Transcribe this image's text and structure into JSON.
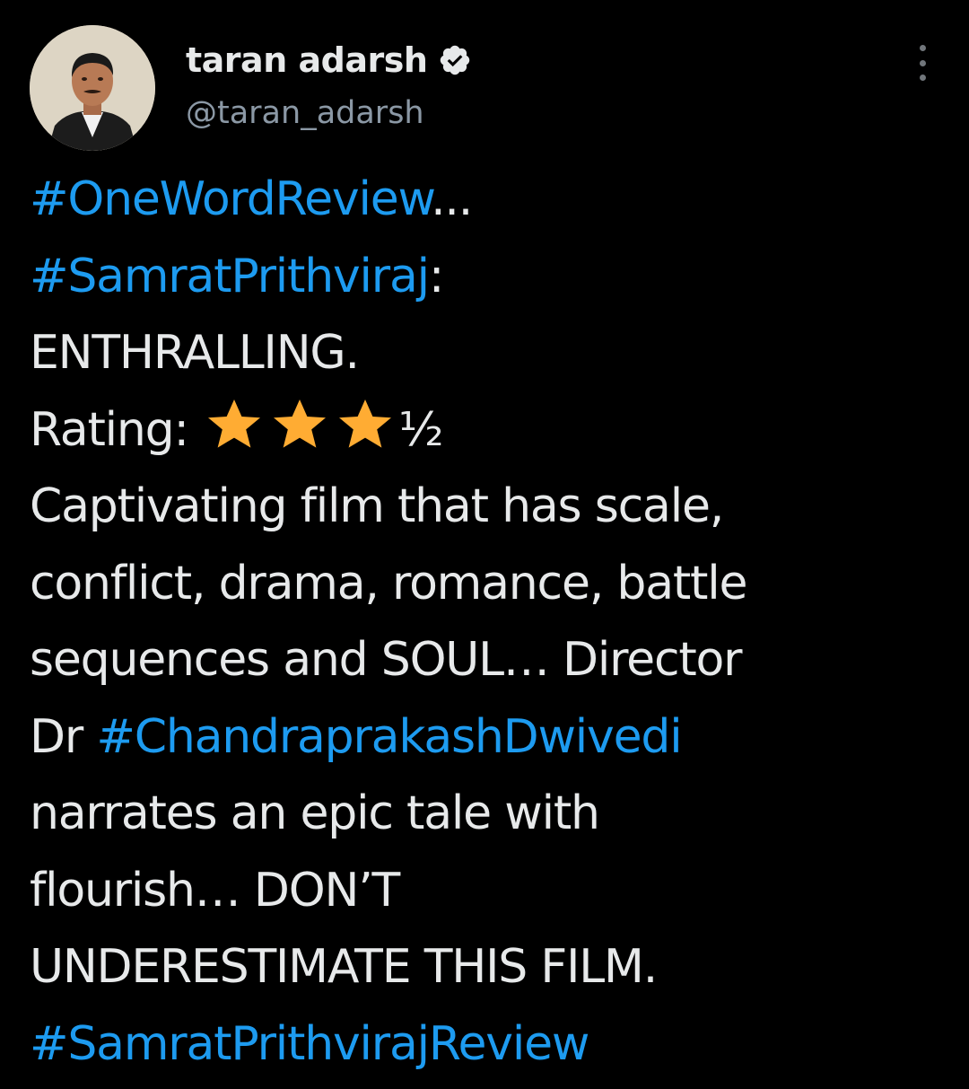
{
  "user": {
    "display_name": "taran adarsh",
    "handle": "@taran_adarsh",
    "verified": true,
    "avatar_icon": "profile-photo"
  },
  "colors": {
    "background": "#000000",
    "text": "#e7e9ea",
    "hashtag": "#1d9bf0",
    "secondary": "#8b98a5",
    "star": "#ffac33"
  },
  "tweet": {
    "line1": {
      "hashtag": "#OneWordReview",
      "text": "..."
    },
    "line2": {
      "hashtag": "#SamratPrithviraj",
      "text": ":"
    },
    "line3": "ENTHRALLING.",
    "rating": {
      "label": "Rating:",
      "stars": 3.5,
      "half": "½"
    },
    "line5": "Captivating film that has scale,",
    "line6": "conflict, drama, romance, battle",
    "line7": "sequences and SOUL… Director",
    "line8": {
      "text": "Dr ",
      "hashtag": "#ChandraprakashDwivedi"
    },
    "line9": "narrates an epic tale with",
    "line10": "flourish… DON’T",
    "line11": "UNDERESTIMATE THIS FILM.",
    "line12": {
      "hashtag": "#SamratPrithvirajReview"
    }
  }
}
